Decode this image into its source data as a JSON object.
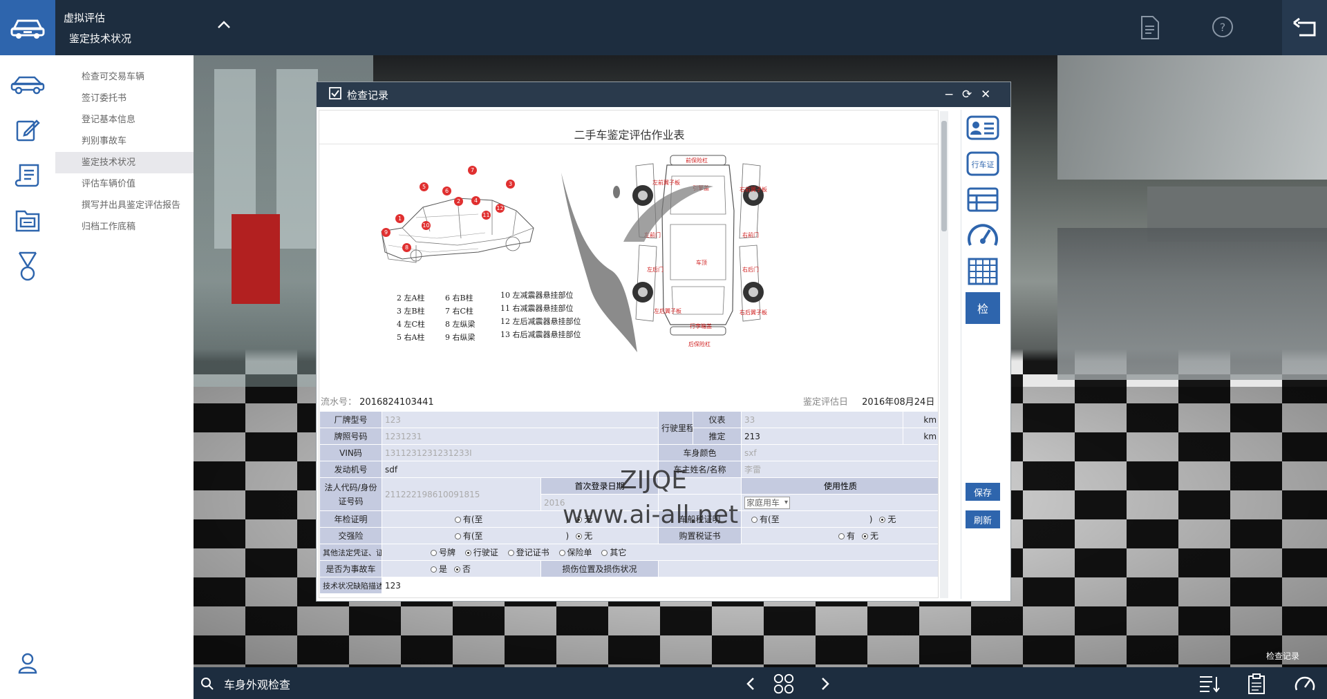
{
  "header": {
    "title": "虚拟评估",
    "subtitle": "鉴定技术状况"
  },
  "sidebar": {
    "items": [
      {
        "label": "检查可交易车辆"
      },
      {
        "label": "签订委托书"
      },
      {
        "label": "登记基本信息"
      },
      {
        "label": "判别事故车"
      },
      {
        "label": "鉴定技术状况"
      },
      {
        "label": "评估车辆价值"
      },
      {
        "label": "撰写并出具鉴定评估报告"
      },
      {
        "label": "归档工作底稿"
      }
    ]
  },
  "dialog": {
    "title": "检查记录",
    "doc_title": "二手车鉴定评估作业表",
    "serial_label": "流水号：",
    "serial_value": "2016824103441",
    "date_label": "鉴定评估日",
    "date_value": "2016年08月24日",
    "legend_col1": [
      "2 左A柱",
      "3 左B柱",
      "4 左C柱",
      "5 右A柱"
    ],
    "legend_col2": [
      "6 右B柱",
      "7 右C柱",
      "8 左纵梁",
      "9 右纵梁"
    ],
    "legend_col3": [
      "10 左减震器悬挂部位",
      "11 右减震器悬挂部位",
      "12 左后减震器悬挂部位",
      "13 右后减震器悬挂部位"
    ],
    "side_markers": [
      "7",
      "5",
      "6",
      "2",
      "3",
      "4",
      "1",
      "12",
      "10",
      "11",
      "9",
      "8"
    ],
    "top_labels": [
      "前保险杠",
      "左前翼子板",
      "引擎盖",
      "右前翼子板",
      "左前门",
      "右前门",
      "车顶",
      "左后门",
      "右后门",
      "左后翼子板",
      "行李箱盖",
      "右后翼子板",
      "后保险杠"
    ],
    "form": {
      "model_label": "厂牌型号",
      "model_value": "123",
      "plate_label": "牌照号码",
      "plate_value": "1231231",
      "vin_label": "VIN码",
      "vin_value": "1311231231231233I",
      "engine_label": "发动机号",
      "engine_value": "sdf",
      "mileage_label": "行驶里程",
      "meter_label": "仪表",
      "meter_value": "33",
      "meter_unit": "km",
      "est_label": "推定",
      "est_value": "213",
      "est_unit": "km",
      "color_label": "车身颜色",
      "color_value": "sxf",
      "owner_label": "车主姓名/名称",
      "owner_value": "李雷",
      "legal_label": "法人代码/身份证号码",
      "legal_value": "211222198610091815",
      "reg_date_label": "首次登录日期",
      "reg_date_value": "2016",
      "usage_label": "使用性质",
      "usage_value": "家庭用车",
      "annual_label": "年检证明",
      "annual_has": "有(至",
      "annual_none": "无",
      "tax_label": "车船税证明",
      "tax_has": "有(至",
      "tax_none": "无",
      "insure_label": "交强险",
      "insure_has": "有(至",
      "insure_none": "无",
      "purchase_label": "购置税证书",
      "purchase_has": "有",
      "purchase_none": "无",
      "other_label": "其他法定凭证、证明",
      "other_opts": [
        "号牌",
        "行驶证",
        "登记证书",
        "保险单",
        "其它"
      ],
      "accident_label": "是否为事故车",
      "accident_yes": "是",
      "accident_no": "否",
      "damage_label": "损伤位置及损伤状况",
      "defect_label": "技术状况缺陷描述",
      "defect_value": "123"
    },
    "side_buttons": {
      "check": "检",
      "save": "保存",
      "refresh": "刷新",
      "license": "行车证"
    }
  },
  "watermark": {
    "line1": "ZIJQE",
    "line2": "www.ai-all.net"
  },
  "scene": {
    "label": "检查记录"
  },
  "bottombar": {
    "text": "车身外观检查"
  },
  "colors": {
    "topbar": "#1d2d3f",
    "accent": "#2e65ad",
    "form_label": "#c5cbe0",
    "form_value": "#dfe3f0"
  }
}
